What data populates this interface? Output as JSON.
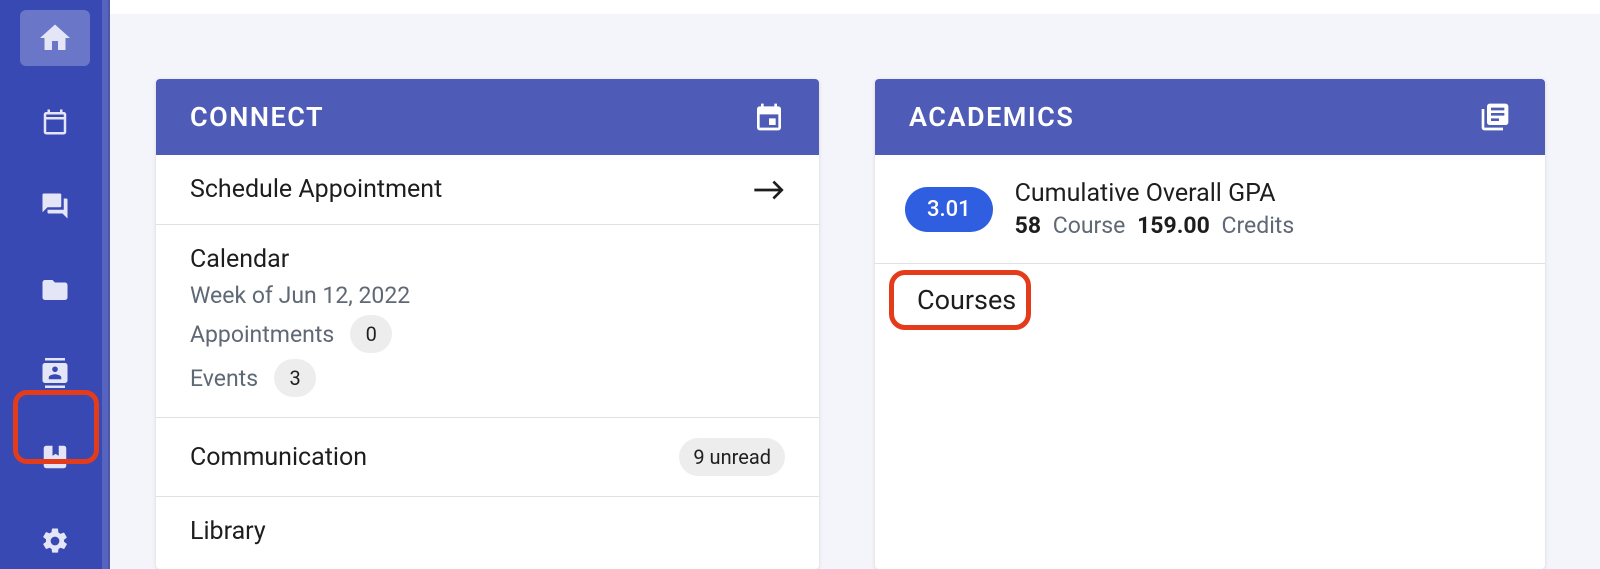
{
  "sidebar": {
    "items": [
      {
        "name": "home"
      },
      {
        "name": "calendar"
      },
      {
        "name": "chat"
      },
      {
        "name": "folder"
      },
      {
        "name": "contacts"
      },
      {
        "name": "bookmark"
      },
      {
        "name": "settings"
      }
    ]
  },
  "connect": {
    "title": "CONNECT",
    "schedule_label": "Schedule Appointment",
    "calendar": {
      "title": "Calendar",
      "week_label": "Week of Jun 12, 2022",
      "appointments_label": "Appointments",
      "appointments_count": "0",
      "events_label": "Events",
      "events_count": "3"
    },
    "communication": {
      "label": "Communication",
      "badge": "9 unread"
    },
    "library_label": "Library"
  },
  "academics": {
    "title": "ACADEMICS",
    "gpa_value": "3.01",
    "gpa_label": "Cumulative Overall GPA",
    "course_count": "58",
    "course_label": "Course",
    "credits_value": "159.00",
    "credits_label": "Credits",
    "courses_label": "Courses"
  }
}
